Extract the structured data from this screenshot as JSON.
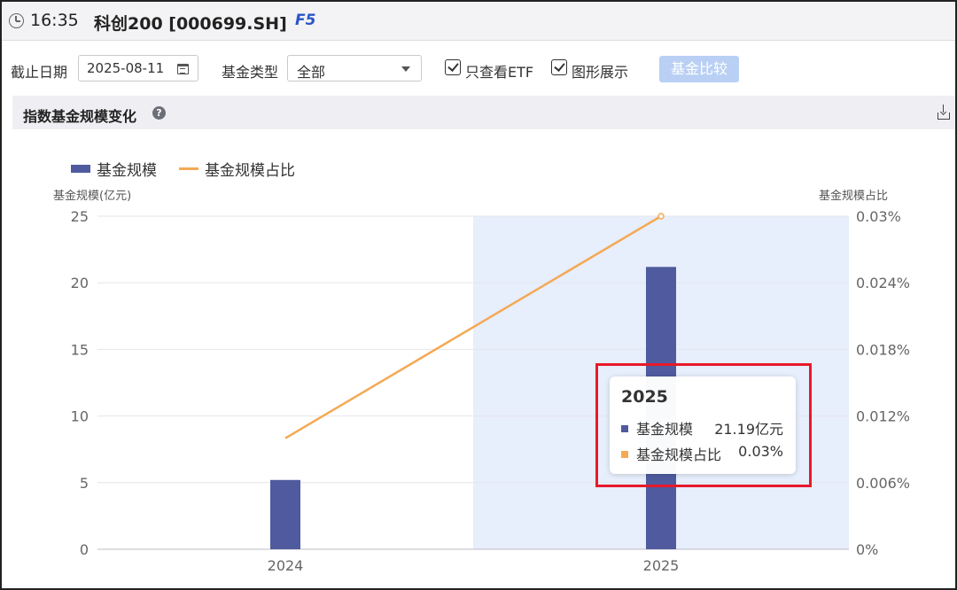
{
  "header": {
    "time": "16:35",
    "security": "科创200 [000699.SH]",
    "hotkey": "F5"
  },
  "toolbar": {
    "date_label": "截止日期",
    "date_value": "2025-08-11",
    "fund_type_label": "基金类型",
    "fund_type_value": "全部",
    "etf_only_label": "只查看ETF",
    "etf_only_checked": true,
    "chart_view_label": "图形展示",
    "chart_view_checked": true,
    "compare_button": "基金比较"
  },
  "panel": {
    "title": "指数基金规模变化",
    "help_icon": "question-circle-icon",
    "download_icon": "download-icon"
  },
  "chart_data": {
    "type": "bar",
    "categories": [
      "2024",
      "2025"
    ],
    "series": [
      {
        "name": "基金规模",
        "type": "bar",
        "axis": "left",
        "values": [
          5.2,
          21.19
        ],
        "color": "#4f5b9e"
      },
      {
        "name": "基金规模占比",
        "type": "line",
        "axis": "right",
        "values": [
          0.01,
          0.03
        ],
        "color": "#f4a955"
      }
    ],
    "ylabel_left": "基金规模(亿元)",
    "ylabel_right": "基金规模占比",
    "ylim_left": [
      0,
      25
    ],
    "ylim_right": [
      0,
      0.03
    ],
    "left_ticks": [
      "0",
      "5",
      "10",
      "15",
      "20",
      "25"
    ],
    "right_ticks": [
      "0%",
      "0.006%",
      "0.012%",
      "0.018%",
      "0.024%",
      "0.03%"
    ],
    "grid": true,
    "legend_position": "top-left",
    "highlighted_category": "2025"
  },
  "tooltip": {
    "title": "2025",
    "rows": [
      {
        "name": "基金规模",
        "value": "21.19亿元",
        "color": "#4f5b9e"
      },
      {
        "name": "基金规模占比",
        "value": "0.03%",
        "color": "#f4a955"
      }
    ]
  }
}
